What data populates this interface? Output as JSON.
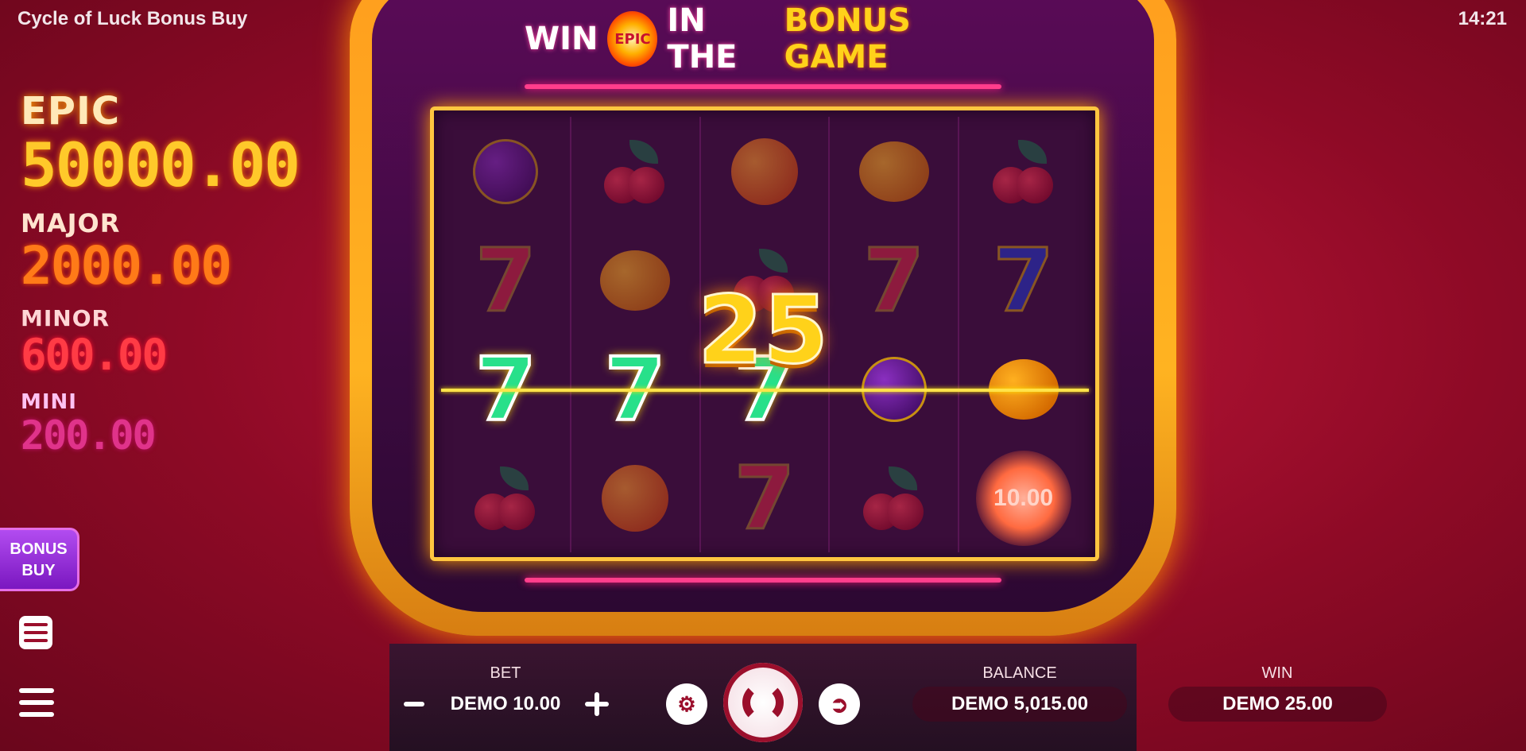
{
  "header": {
    "title": "Cycle of Luck Bonus Buy",
    "time": "14:21"
  },
  "jackpots": [
    {
      "label": "EPIC",
      "value": "50000.00"
    },
    {
      "label": "MAJOR",
      "value": "2000.00"
    },
    {
      "label": "MINOR",
      "value": "600.00"
    },
    {
      "label": "MINI",
      "value": "200.00"
    }
  ],
  "bonus_buy": {
    "line1": "BONUS",
    "line2": "BUY"
  },
  "headline": {
    "win": "WIN",
    "badge": "EPIC",
    "middle": "IN THE",
    "bonus": "BONUS GAME"
  },
  "reels": [
    [
      "plum",
      "seven-red",
      "seven-green",
      "cherry"
    ],
    [
      "cherry",
      "lemon",
      "seven-green",
      "orange"
    ],
    [
      "orange",
      "cherry",
      "seven-green",
      "seven-red"
    ],
    [
      "lemon",
      "seven-red",
      "plum",
      "cherry"
    ],
    [
      "cherry",
      "seven-blue",
      "lemon",
      "coin"
    ]
  ],
  "coin_value": "10.00",
  "win_amount": "25",
  "controls": {
    "bet_label": "BET",
    "bet_value": "DEMO 10.00",
    "balance_label": "BALANCE",
    "balance_value": "DEMO 5,015.00",
    "win_label": "WIN",
    "win_value": "DEMO 25.00"
  },
  "colors": {
    "epic": "#ffc92a",
    "major": "#ff7a18",
    "minor": "#ff3b45",
    "mini": "#e0338a",
    "frame": "#ffc640",
    "bonus_buy": "#9b30d8"
  }
}
